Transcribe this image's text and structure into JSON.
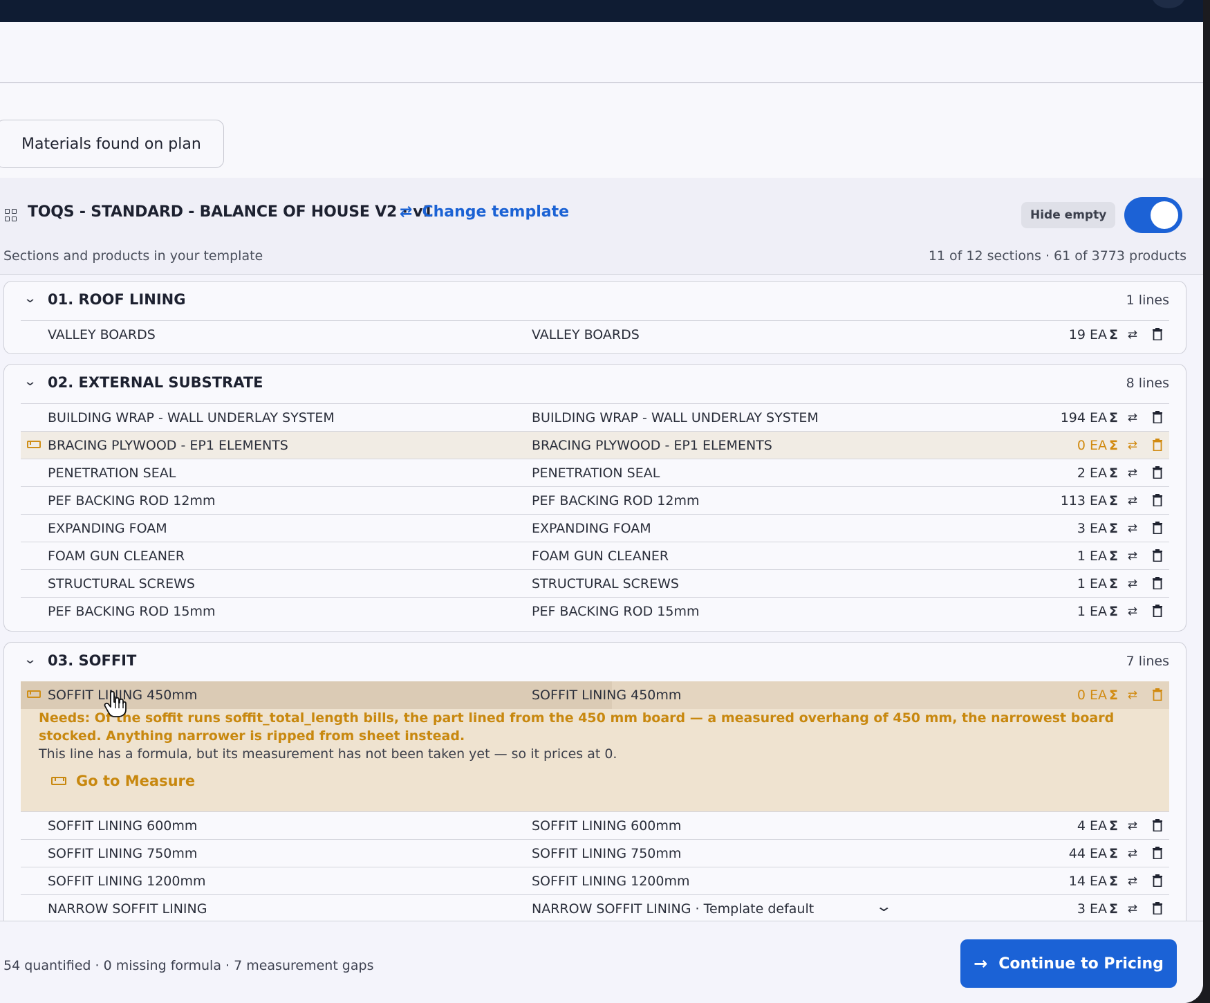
{
  "tab": {
    "label": "Materials found on plan"
  },
  "template": {
    "title": "TOQS - STANDARD - BALANCE OF HOUSE V2 · v1",
    "change_label": "Change template",
    "hide_empty_label": "Hide empty",
    "hide_empty_on": true,
    "subtitle": "Sections and products in your template",
    "counts": "11 of 12 sections · 61 of 3773 products"
  },
  "sections": [
    {
      "title": "01. ROOF LINING",
      "lines": "1 lines",
      "rows": [
        {
          "name": "VALLEY BOARDS",
          "product": "VALLEY BOARDS",
          "qty": "19 EA",
          "warn": false
        }
      ]
    },
    {
      "title": "02. EXTERNAL SUBSTRATE",
      "lines": "8 lines",
      "rows": [
        {
          "name": "BUILDING WRAP - WALL UNDERLAY SYSTEM",
          "product": "BUILDING WRAP - WALL UNDERLAY SYSTEM",
          "qty": "194 EA",
          "warn": false
        },
        {
          "name": "BRACING PLYWOOD - EP1 ELEMENTS",
          "product": "BRACING PLYWOOD - EP1 ELEMENTS",
          "qty": "0 EA",
          "warn": true
        },
        {
          "name": "PENETRATION SEAL",
          "product": "PENETRATION SEAL",
          "qty": "2 EA",
          "warn": false
        },
        {
          "name": "PEF BACKING ROD 12mm",
          "product": "PEF BACKING ROD 12mm",
          "qty": "113 EA",
          "warn": false
        },
        {
          "name": "EXPANDING FOAM",
          "product": "EXPANDING FOAM",
          "qty": "3 EA",
          "warn": false
        },
        {
          "name": "FOAM GUN CLEANER",
          "product": "FOAM GUN CLEANER",
          "qty": "1 EA",
          "warn": false
        },
        {
          "name": "STRUCTURAL SCREWS",
          "product": "STRUCTURAL SCREWS",
          "qty": "1 EA",
          "warn": false
        },
        {
          "name": "PEF BACKING ROD 15mm",
          "product": "PEF BACKING ROD 15mm",
          "qty": "1 EA",
          "warn": false
        }
      ]
    },
    {
      "title": "03. SOFFIT",
      "lines": "7 lines",
      "expanded_row": {
        "name": "SOFFIT LINING 450mm",
        "product": "SOFFIT LINING 450mm",
        "qty": "0 EA",
        "needs": "Needs: Of the soffit runs soffit_total_length bills, the part lined from the 450 mm board — a measured overhang of 450 mm, the narrowest board stocked. Anything narrower is ripped from sheet instead.",
        "explain": "This line has a formula, but its measurement has not been taken yet — so it prices at 0.",
        "action": "Go to Measure"
      },
      "rows": [
        {
          "name": "SOFFIT LINING 600mm",
          "product": "SOFFIT LINING 600mm",
          "qty": "4 EA",
          "warn": false
        },
        {
          "name": "SOFFIT LINING 750mm",
          "product": "SOFFIT LINING 750mm",
          "qty": "44 EA",
          "warn": false
        },
        {
          "name": "SOFFIT LINING 1200mm",
          "product": "SOFFIT LINING 1200mm",
          "qty": "14 EA",
          "warn": false
        },
        {
          "name": "NARROW SOFFIT LINING",
          "product": "NARROW SOFFIT LINING · Template default",
          "qty": "3 EA",
          "warn": false
        }
      ]
    }
  ],
  "sigma": "Σ",
  "footer": {
    "status": "54 quantified · 0 missing formula · 7 measurement gaps",
    "continue_label": "Continue to Pricing"
  },
  "colors": {
    "accent": "#1b62d6",
    "warning": "#c8880f",
    "topbar": "#0f1c33"
  },
  "icons": [
    "grid-icon",
    "swap-icon",
    "toggle",
    "chevron-down-icon",
    "ruler-icon",
    "sum-icon",
    "trash-icon",
    "arrow-right-icon"
  ]
}
